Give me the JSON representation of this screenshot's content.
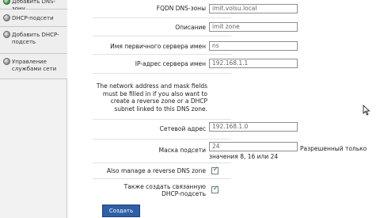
{
  "sidebar": {
    "items": [
      {
        "label": "Добавить DNS-зону",
        "icon": "dns-zone-icon"
      },
      {
        "label": "DHCP-подсети",
        "icon": "dhcp-subnets-icon"
      },
      {
        "label": "Добавить DHCP-подсеть",
        "icon": "add-dhcp-subnet-icon"
      },
      {
        "label": "Управление службами сети",
        "icon": "network-services-icon"
      }
    ]
  },
  "form": {
    "fqdn": {
      "label": "FQDN DNS-зоны",
      "value": "imit.volsu.local"
    },
    "description": {
      "label": "Описание",
      "value": "imit zone"
    },
    "primary_ns_name": {
      "label": "Имя первичного сервера имен",
      "value": "ns"
    },
    "primary_ns_ip": {
      "label": "IP-адрес сервера имен",
      "value": "192.168.1.1"
    },
    "note": "The network address and mask fields must be filled in if you also want to create a reverse zone or a DHCP subnet linked to this DNS zone.",
    "network_address": {
      "label": "Сетевой адрес",
      "value": "192.168.1.0"
    },
    "subnet_mask": {
      "label": "Маска подсети",
      "value": "24",
      "hint_line1": "Разрешенный только",
      "hint_line2": "значения 8, 16 или 24"
    },
    "reverse_zone": {
      "label": "Also manage a reverse DNS zone",
      "checked": true
    },
    "create_dhcp": {
      "label_line1": "Также создать связанную",
      "label_line2": "DHCP-подсеть",
      "checked": true
    },
    "submit_label": "Создать"
  }
}
